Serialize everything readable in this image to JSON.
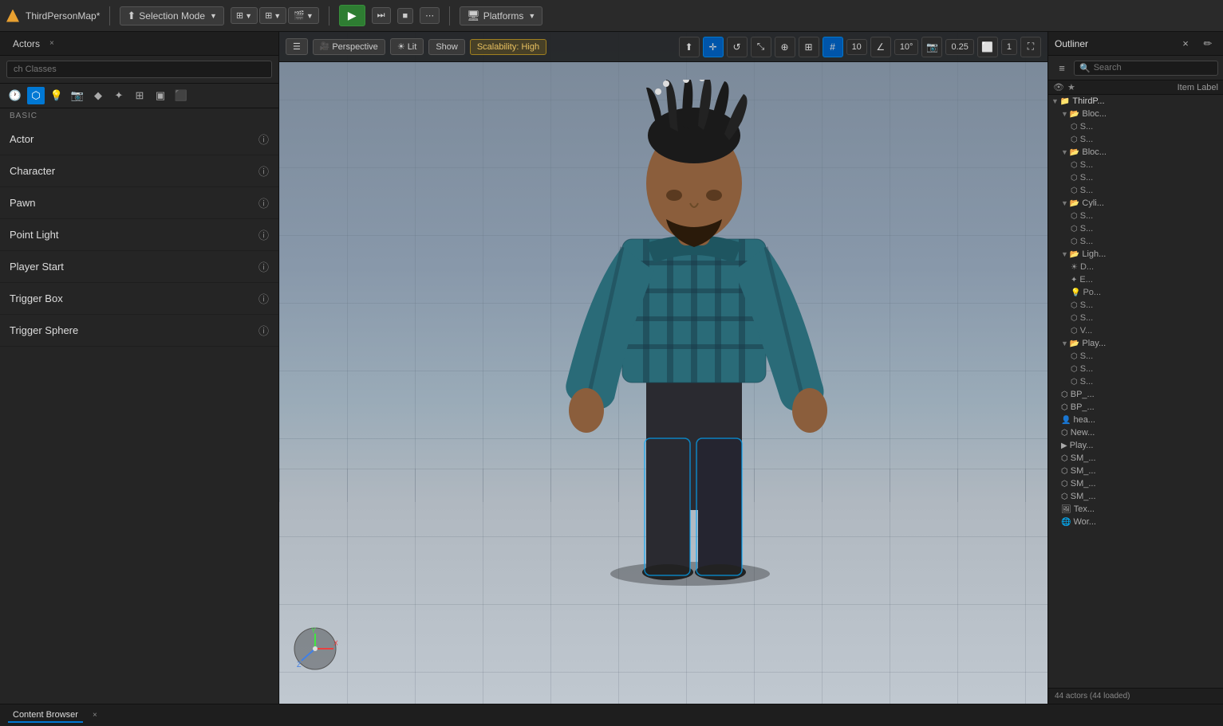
{
  "app": {
    "title": "ThirdPersonMap*",
    "icon": "triangle-icon"
  },
  "top_bar": {
    "selection_mode_label": "Selection Mode",
    "platforms_label": "Platforms",
    "play_icon": "▶",
    "play_skip_icon": "⏭",
    "stop_icon": "■",
    "more_icon": "⋯"
  },
  "actors_panel": {
    "tab_label": "Actors",
    "close_icon": "×",
    "search_placeholder": "ch Classes",
    "section_label": "BASIC",
    "items": [
      {
        "name": "Actor",
        "id": "actor"
      },
      {
        "name": "Character",
        "id": "character"
      },
      {
        "name": "Pawn",
        "id": "pawn"
      },
      {
        "name": "Point Light",
        "id": "point-light"
      },
      {
        "name": "Player Start",
        "id": "player-start"
      },
      {
        "name": "Trigger Box",
        "id": "trigger-box"
      },
      {
        "name": "Trigger Sphere",
        "id": "trigger-sphere"
      }
    ]
  },
  "viewport": {
    "camera_mode": "Perspective",
    "lighting_mode": "Lit",
    "show_label": "Show",
    "scalability_label": "Scalability: High",
    "grid_size": "10",
    "angle": "10°",
    "camera_speed": "0.25",
    "screen_pct": "1"
  },
  "outliner": {
    "title": "Outliner",
    "close_icon": "×",
    "edit_icon": "✏",
    "search_placeholder": "Search",
    "col_visibility": "👁",
    "col_lock": "★",
    "col_item_label": "Item Label",
    "items": [
      {
        "type": "parent",
        "name": "ThirdP...",
        "level": 0
      },
      {
        "type": "group",
        "name": "Bloc...",
        "level": 1,
        "expanded": true
      },
      {
        "type": "child",
        "name": "S...",
        "level": 2
      },
      {
        "type": "child",
        "name": "S...",
        "level": 2
      },
      {
        "type": "group",
        "name": "Bloc...",
        "level": 1,
        "expanded": true
      },
      {
        "type": "child",
        "name": "S...",
        "level": 2
      },
      {
        "type": "child",
        "name": "S...",
        "level": 2
      },
      {
        "type": "child",
        "name": "S...",
        "level": 2
      },
      {
        "type": "group",
        "name": "Cyli...",
        "level": 1,
        "expanded": true
      },
      {
        "type": "child",
        "name": "S...",
        "level": 2
      },
      {
        "type": "child",
        "name": "S...",
        "level": 2
      },
      {
        "type": "child",
        "name": "S...",
        "level": 2
      },
      {
        "type": "group",
        "name": "Ligh...",
        "level": 1,
        "expanded": true
      },
      {
        "type": "child",
        "name": "D...",
        "level": 2
      },
      {
        "type": "child",
        "name": "E...",
        "level": 2
      },
      {
        "type": "child",
        "name": "Po...",
        "level": 2
      },
      {
        "type": "child",
        "name": "S...",
        "level": 2
      },
      {
        "type": "child",
        "name": "S...",
        "level": 2
      },
      {
        "type": "child",
        "name": "V...",
        "level": 2
      },
      {
        "type": "group",
        "name": "Play...",
        "level": 1,
        "expanded": true
      },
      {
        "type": "child",
        "name": "S...",
        "level": 2
      },
      {
        "type": "child",
        "name": "S...",
        "level": 2
      },
      {
        "type": "child",
        "name": "S...",
        "level": 2
      },
      {
        "type": "child",
        "name": "BP_...",
        "level": 1
      },
      {
        "type": "child",
        "name": "BP_...",
        "level": 1
      },
      {
        "type": "child",
        "name": "hea...",
        "level": 1
      },
      {
        "type": "child",
        "name": "New...",
        "level": 1
      },
      {
        "type": "child",
        "name": "Play...",
        "level": 1
      },
      {
        "type": "child",
        "name": "SM_...",
        "level": 1
      },
      {
        "type": "child",
        "name": "SM_...",
        "level": 1
      },
      {
        "type": "child",
        "name": "SM_...",
        "level": 1
      },
      {
        "type": "child",
        "name": "SM_...",
        "level": 1
      },
      {
        "type": "child",
        "name": "Tex...",
        "level": 1
      },
      {
        "type": "child",
        "name": "Wor...",
        "level": 1
      }
    ],
    "footer": "44 actors (44 loaded)"
  },
  "bottom_bar": {
    "tab1": "Content Browser",
    "tab1_close": "×"
  },
  "colors": {
    "accent_blue": "#0078d4",
    "accent_green": "#2e7d32",
    "scalability_bg": "#5a4a00",
    "scalability_text": "#e8c060",
    "toolbar_bg": "#2a2a2a",
    "panel_bg": "#252525"
  }
}
